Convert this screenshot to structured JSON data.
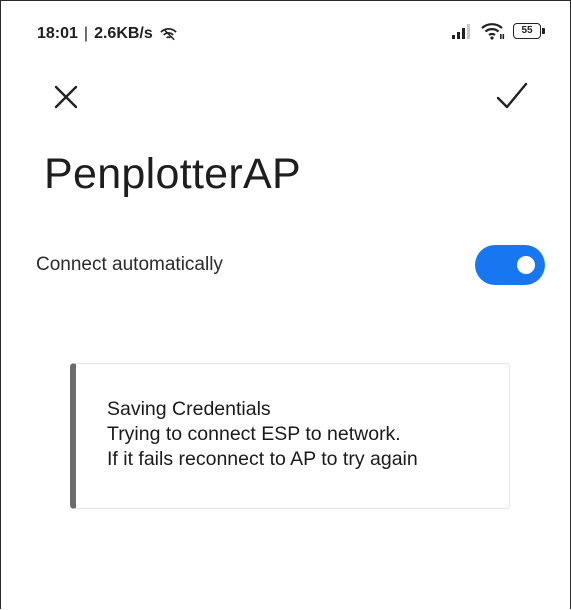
{
  "status_bar": {
    "time": "18:01",
    "separator": "|",
    "net_speed": "2.6KB/s",
    "battery_level": "55",
    "icons": [
      "hotspot-icon",
      "signal-icon",
      "wifi-icon",
      "battery-icon"
    ]
  },
  "toolbar": {
    "close_icon": "close-icon",
    "confirm_icon": "check-icon"
  },
  "network": {
    "name": "PenplotterAP"
  },
  "settings": {
    "auto_connect_label": "Connect automatically",
    "auto_connect_enabled": true,
    "toggle_color": "#1677f0"
  },
  "message": {
    "lines": [
      "Saving Credentials",
      "Trying to connect ESP to network.",
      "If it fails reconnect to AP to try again"
    ],
    "accent_color": "#6c6c6c"
  }
}
